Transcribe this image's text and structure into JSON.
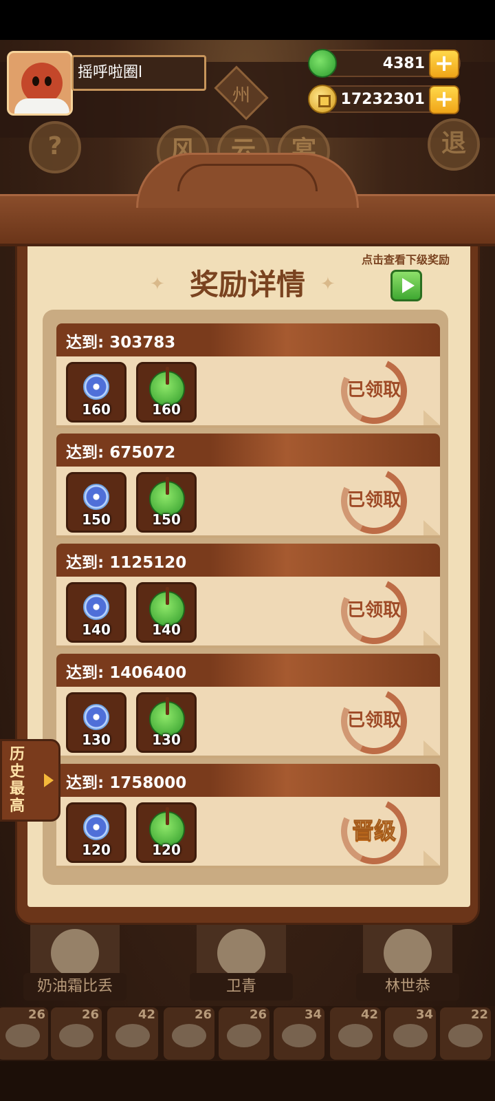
{
  "header": {
    "player_name": "摇呼啦圈l",
    "sign_char": "州",
    "jade_amount": "4381",
    "coin_amount": "17232301",
    "plus_label": "+",
    "round_buttons": [
      "?",
      "风",
      "云",
      "宴",
      "退"
    ]
  },
  "panel": {
    "title": "奖励详情",
    "title_deco": "✦",
    "next_hint": "点击查看下级奖励",
    "cards": [
      {
        "label": "达到: 303783",
        "disc_qty": "160",
        "jade_qty": "160",
        "status": "已领取"
      },
      {
        "label": "达到: 675072",
        "disc_qty": "150",
        "jade_qty": "150",
        "status": "已领取"
      },
      {
        "label": "达到: 1125120",
        "disc_qty": "140",
        "jade_qty": "140",
        "status": "已领取"
      },
      {
        "label": "达到: 1406400",
        "disc_qty": "130",
        "jade_qty": "130",
        "status": "已领取"
      },
      {
        "label": "达到: 1758000",
        "disc_qty": "120",
        "jade_qty": "120",
        "status": "晋级"
      }
    ]
  },
  "side_tab": {
    "label": "历史最高"
  },
  "characters": [
    "奶油霜比丢",
    "卫青",
    "林世恭"
  ],
  "dishes": [
    "26",
    "26",
    "42",
    "26",
    "26",
    "34",
    "42",
    "34",
    "22"
  ],
  "colors": {
    "accent_brown": "#7a3b1c",
    "paper": "#f1deb8",
    "stamp": "#b8613a",
    "promote": "#f5b93a"
  }
}
